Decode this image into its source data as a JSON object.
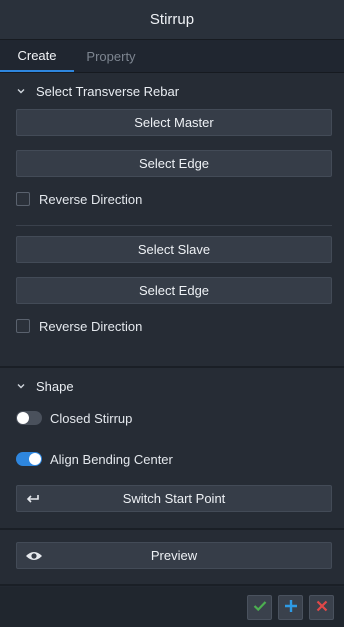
{
  "window": {
    "title": "Stirrup"
  },
  "tabs": [
    {
      "label": "Create",
      "active": true
    },
    {
      "label": "Property",
      "active": false
    }
  ],
  "transverse": {
    "header": "Select Transverse Rebar",
    "select_master": "Select Master",
    "select_edge_1": "Select Edge",
    "reverse_1": "Reverse Direction",
    "select_slave": "Select Slave",
    "select_edge_2": "Select Edge",
    "reverse_2": "Reverse Direction"
  },
  "shape": {
    "header": "Shape",
    "closed_stirrup": {
      "label": "Closed Stirrup",
      "on": false
    },
    "align_bending_center": {
      "label": "Align Bending Center",
      "on": true
    },
    "switch_start_point": "Switch Start Point"
  },
  "preview": {
    "label": "Preview"
  },
  "footer": {
    "ok_icon": "check-icon",
    "add_icon": "plus-icon",
    "cancel_icon": "close-icon"
  },
  "colors": {
    "accent": "#2e86de",
    "ok": "#4caf50",
    "add": "#2e9be6",
    "cancel": "#e04848"
  }
}
